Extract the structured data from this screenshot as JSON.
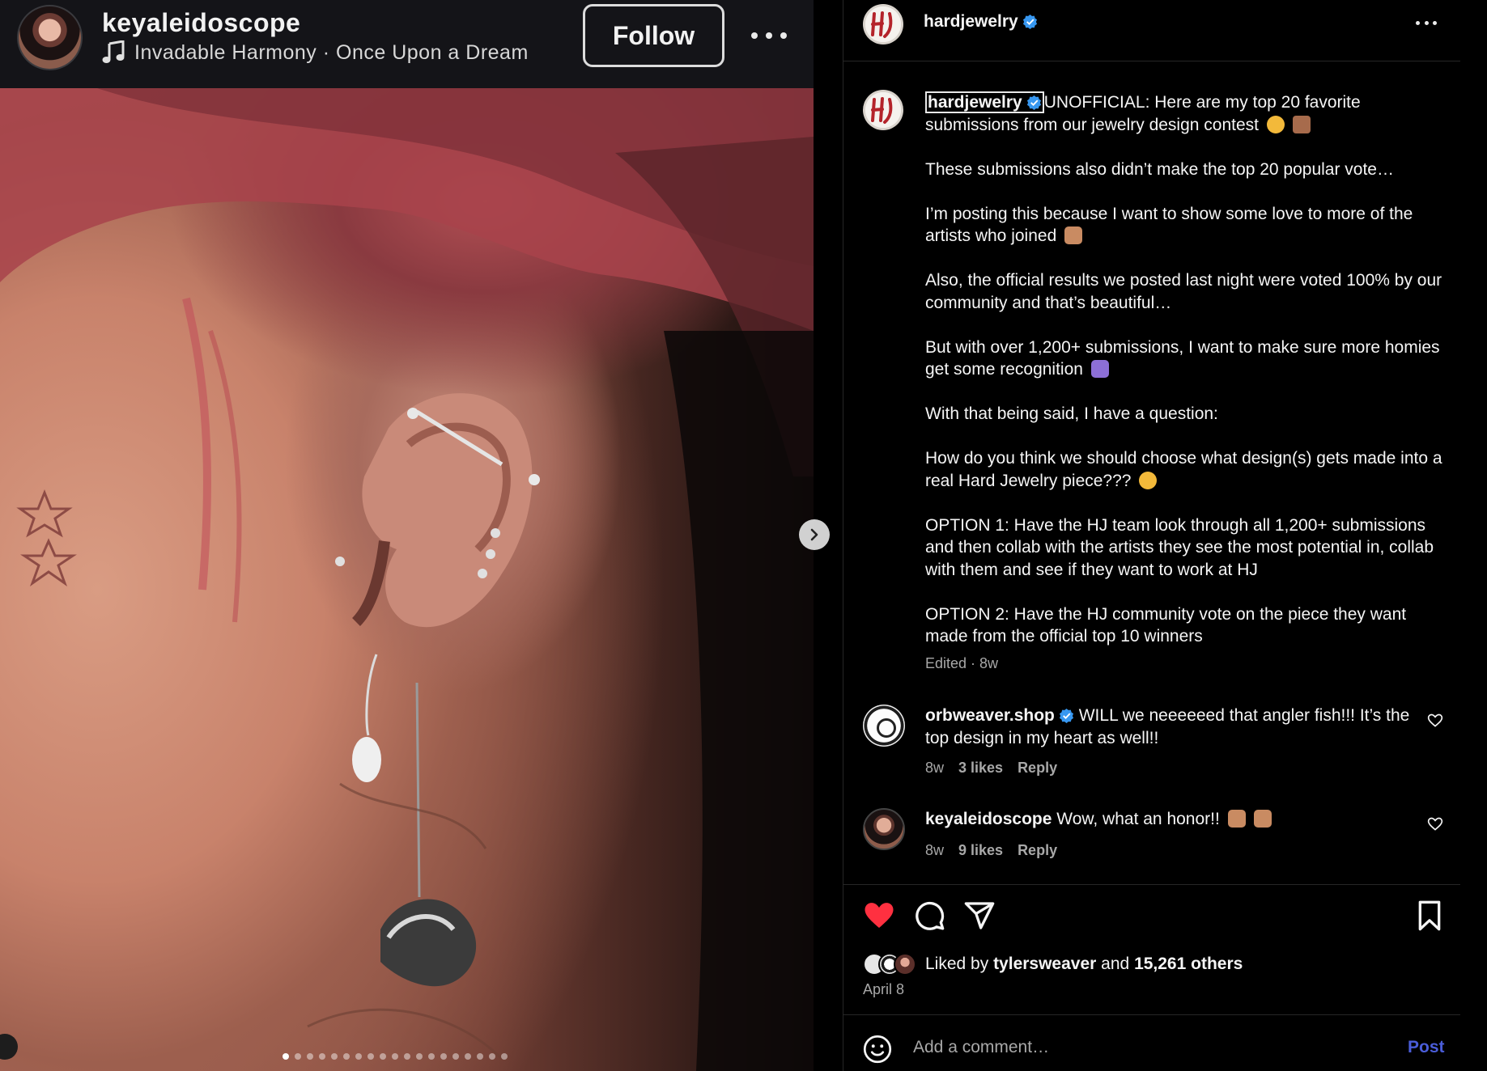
{
  "left": {
    "username": "keyaleidoscope",
    "music": "Invadable Harmony · Once Upon a Dream",
    "follow_label": "Follow",
    "carousel_dots": 19,
    "active_dot": 0
  },
  "post": {
    "username": "hardjewelry",
    "caption_user": "hardjewelry",
    "caption_paragraphs": [
      "UNOFFICIAL: Here are my top 20 favorite submissions from our jewelry design contest",
      "These submissions also didn’t make the top 20 popular vote…",
      "I’m posting this because I want to show some love to more of the artists who joined",
      "Also, the official results we posted last night were voted 100% by our community and that’s beautiful…",
      "But with over 1,200+ submissions, I want to make sure more homies get some recognition",
      "With that being said, I have a question:",
      "How do you think we should choose what design(s) gets made into a real Hard Jewelry piece???",
      "OPTION 1: Have the HJ team look through all 1,200+ submissions and then collab with the artists they see the most potential in, collab with them and see if they want to work at HJ",
      "OPTION 2: Have the HJ community vote on the piece they want made from the official top 10 winners"
    ],
    "caption_meta": "Edited · 8w",
    "comments": [
      {
        "user": "orbweaver.shop",
        "text": "WILL we neeeeeed that angler fish!!! It’s the top design in my heart as well!!",
        "time": "8w",
        "likes": "3 likes",
        "reply": "Reply"
      },
      {
        "user": "keyaleidoscope",
        "text": "Wow, what an honor!!",
        "time": "8w",
        "likes": "9 likes",
        "reply": "Reply"
      }
    ],
    "liked_by_prefix": "Liked by",
    "liked_by_user": "tylersweaver",
    "liked_by_and": "and",
    "liked_by_others": "15,261 others",
    "date": "April 8",
    "comment_placeholder": "Add a comment…",
    "post_label": "Post"
  },
  "colors": {
    "like_red": "#ff3040",
    "post_blue": "#4a5dd9",
    "verified_blue": "#3797f0",
    "secondary_text": "#a8a8a8"
  },
  "icons": [
    "music-note-icon",
    "more-icon",
    "chevron-right-icon",
    "verified-icon",
    "heart-icon",
    "comment-icon",
    "share-icon",
    "bookmark-icon",
    "emoji-icon"
  ]
}
